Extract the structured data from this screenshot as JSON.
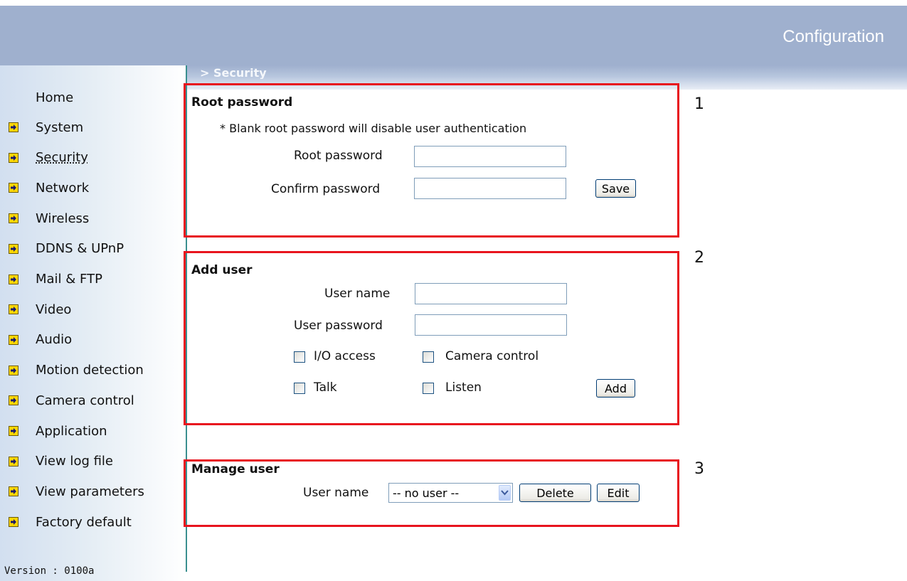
{
  "header": {
    "title": "Configuration"
  },
  "breadcrumb": "> Security",
  "sidebar": {
    "home_label": "Home",
    "items": [
      {
        "label": "System"
      },
      {
        "label": "Security",
        "active": true
      },
      {
        "label": "Network"
      },
      {
        "label": "Wireless"
      },
      {
        "label": "DDNS & UPnP"
      },
      {
        "label": "Mail & FTP"
      },
      {
        "label": "Video"
      },
      {
        "label": "Audio"
      },
      {
        "label": "Motion detection"
      },
      {
        "label": "Camera control"
      },
      {
        "label": "Application"
      },
      {
        "label": "View log file"
      },
      {
        "label": "View parameters"
      },
      {
        "label": "Factory default"
      }
    ],
    "version": "Version : 0100a"
  },
  "root_password": {
    "title": "Root password",
    "note": "* Blank root password will disable user authentication",
    "root_label": "Root password",
    "root_value": "",
    "confirm_label": "Confirm password",
    "confirm_value": "",
    "save_label": "Save",
    "marker": "1"
  },
  "add_user": {
    "title": "Add user",
    "username_label": "User name",
    "username_value": "",
    "password_label": "User password",
    "password_value": "",
    "io_label": "I/O access",
    "camera_label": "Camera control",
    "talk_label": "Talk",
    "listen_label": "Listen",
    "add_label": "Add",
    "marker": "2"
  },
  "manage_user": {
    "title": "Manage user",
    "username_label": "User name",
    "selected": "-- no user --",
    "delete_label": "Delete",
    "edit_label": "Edit",
    "marker": "3"
  },
  "colors": {
    "header": "#9fb0ce",
    "annotation_red": "#e8141e",
    "nav_arrow": "#ffd700"
  },
  "icons": {
    "nav_item": "arrow-right-icon",
    "dropdown": "chevron-down-icon"
  }
}
